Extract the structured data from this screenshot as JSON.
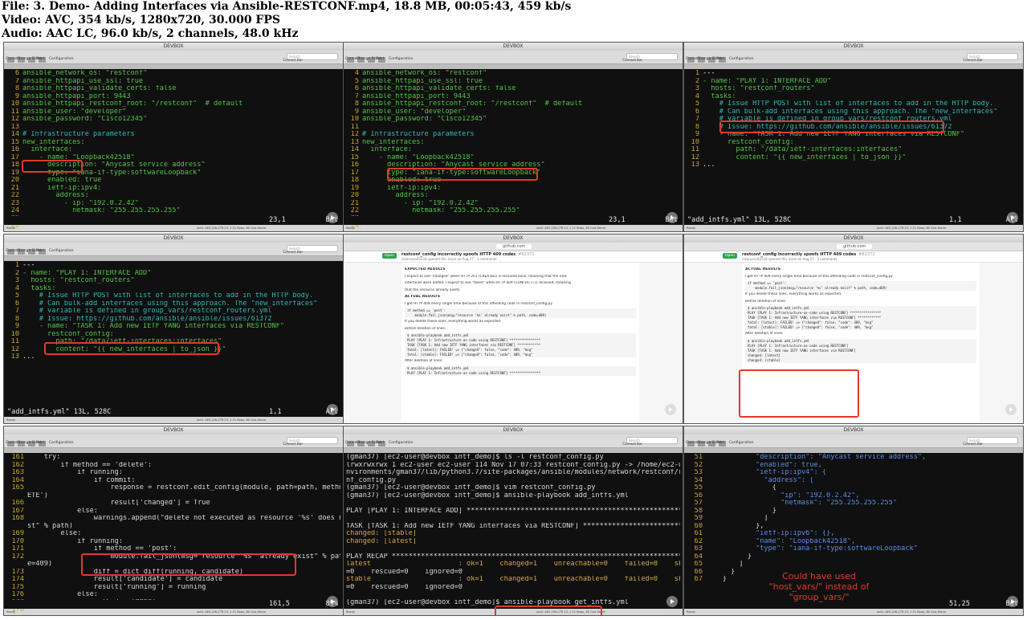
{
  "header": {
    "file": "File: 3. Demo- Adding Interfaces via Ansible-RESTCONF.mp4, 18.8 MB, 00:05:43, 459 kb/s",
    "video": "Video: AVC, 354 kb/s, 1280x720, 30.000 FPS",
    "audio": "Audio: AAC LC, 96.0 kb/s, 2 channels, 48.0 kHz"
  },
  "common": {
    "window_title": "DEVBOX",
    "tab_label": "devbox",
    "toolbar": [
      "Connect",
      "Change State",
      "Print",
      "Configuration"
    ],
    "search_placeholder": "Search",
    "connect_bar": "Connect Bar",
    "status_left": "Ready",
    "status_right": "ssh2: AES-256-CTR    23, 1    21 Rows, 80 Cols    Xterm",
    "browser_url": "github.com"
  },
  "tiles": [
    {
      "status": {
        "pos": "23,1",
        "pct": "Bot"
      },
      "lines": [
        {
          "n": "6",
          "t": "ansible_network_os: \"restconf\""
        },
        {
          "n": "7",
          "t": "ansible_httpapi_use_ssl: true"
        },
        {
          "n": "8",
          "t": "ansible_httpapi_validate_certs: false"
        },
        {
          "n": "9",
          "t": "ansible_httpapi_port: 9443"
        },
        {
          "n": "10",
          "t": "ansible_httpapi_restconf_root: \"/restconf\"  # default"
        },
        {
          "n": "11",
          "t": "ansible_user: \"developer\""
        },
        {
          "n": "12",
          "t": "ansible_password: \"C1sco12345\""
        },
        {
          "n": "13",
          "t": ""
        },
        {
          "n": "14",
          "t": "# Infrastructure parameters"
        },
        {
          "n": "15",
          "t": "new_interfaces:"
        },
        {
          "n": "16",
          "t": "  interface:"
        },
        {
          "n": "17",
          "t": "    - name: \"Loopback42518\""
        },
        {
          "n": "18",
          "t": "      description: \"Anycast service address\""
        },
        {
          "n": "19",
          "t": "      type: \"iana-if-type:softwareLoopback\""
        },
        {
          "n": "20",
          "t": "      enabled: true"
        },
        {
          "n": "21",
          "t": "      ietf-ip:ipv4:"
        },
        {
          "n": "22",
          "t": "        address:"
        },
        {
          "n": "23",
          "t": "          - ip: \"192.0.2.42\""
        },
        {
          "n": "24",
          "t": "            netmask: \"255.255.255.255\""
        },
        {
          "n": "25",
          "t": ""
        },
        {
          "n": "26",
          "t": "."
        }
      ]
    },
    {
      "status": {
        "pos": "23,1",
        "pct": "Bot"
      },
      "lines": [
        {
          "n": "4",
          "t": "ansible_network_os: \"restconf\""
        },
        {
          "n": "5",
          "t": "ansible_httpapi_use_ssl: true"
        },
        {
          "n": "6",
          "t": "ansible_httpapi_validate_certs: false"
        },
        {
          "n": "7",
          "t": "ansible_httpapi_port: 9443"
        },
        {
          "n": "8",
          "t": "ansible_httpapi_restconf_root: \"/restconf\"  # default"
        },
        {
          "n": "9",
          "t": "ansible_user: \"developer\""
        },
        {
          "n": "10",
          "t": "ansible_password: \"C1sco12345\""
        },
        {
          "n": "11",
          "t": ""
        },
        {
          "n": "12",
          "t": "# Infrastructure parameters"
        },
        {
          "n": "13",
          "t": "new_interfaces:"
        },
        {
          "n": "14",
          "t": "  interface:"
        },
        {
          "n": "15",
          "t": "    - name: \"Loopback42518\""
        },
        {
          "n": "16",
          "t": "      description: \"Anycast service address\""
        },
        {
          "n": "17",
          "t": "      type: \"iana-if-type:softwareLoopback\""
        },
        {
          "n": "18",
          "t": "      enabled: true"
        },
        {
          "n": "19",
          "t": "      ietf-ip:ipv4:"
        },
        {
          "n": "20",
          "t": "        address:"
        },
        {
          "n": "21",
          "t": "          - ip: \"192.0.2.42\""
        },
        {
          "n": "22",
          "t": "            netmask: \"255.255.255.255\""
        },
        {
          "n": "23",
          "t": ""
        },
        {
          "n": "24",
          "t": "."
        }
      ]
    },
    {
      "status": {
        "file": "\"add_intfs.yml\" 13L, 528C",
        "pos": "1,1",
        "pct": "All"
      },
      "lines": [
        {
          "n": "1",
          "t": "---"
        },
        {
          "n": "2",
          "t": "- name: \"PLAY 1: INTERFACE ADD\""
        },
        {
          "n": "3",
          "t": "  hosts: \"restconf_routers\""
        },
        {
          "n": "4",
          "t": "  tasks:"
        },
        {
          "n": "5",
          "t": "    # Issue HTTP POST with list of interfaces to add in the HTTP body."
        },
        {
          "n": "6",
          "t": "    # Can bulk-add interfaces using this approach. The \"new_interfaces\""
        },
        {
          "n": "7",
          "t": "    # variable is defined in group_vars/restconf_routers.yml"
        },
        {
          "n": "8",
          "t": "    # Issue: https://github.com/ansible/ansible/issues/61372"
        },
        {
          "n": "9",
          "t": "    - name: \"TASK 1: Add new IETF YANG interfaces via RESTCONF\""
        },
        {
          "n": "10",
          "t": "      restconf_config:"
        },
        {
          "n": "11",
          "t": "        path: \"/data/ietf-interfaces:interfaces\""
        },
        {
          "n": "12",
          "t": "        content: \"{{ new_interfaces | to_json }}\""
        },
        {
          "n": "13",
          "t": "..."
        }
      ]
    },
    {
      "status": {
        "file": "\"add_intfs.yml\" 13L, 528C",
        "pos": "1,1",
        "pct": "All"
      },
      "lines": [
        {
          "n": "1",
          "t": "---"
        },
        {
          "n": "2",
          "t": "- name: \"PLAY 1: INTERFACE ADD\""
        },
        {
          "n": "3",
          "t": "  hosts: \"restconf_routers\""
        },
        {
          "n": "4",
          "t": "  tasks:"
        },
        {
          "n": "5",
          "t": "    # Issue HTTP POST with list of interfaces to add in the HTTP body."
        },
        {
          "n": "6",
          "t": "    # Can bulk-add interfaces using this approach. The \"new_interfaces\""
        },
        {
          "n": "7",
          "t": "    # variable is defined in group_vars/restconf_routers.yml"
        },
        {
          "n": "8",
          "t": "    # Issue: https://github.com/ansible/ansible/issues/61372"
        },
        {
          "n": "9",
          "t": "    - name: \"TASK 1: Add new IETF YANG interfaces via RESTCONF\""
        },
        {
          "n": "10",
          "t": "      restconf_config:"
        },
        {
          "n": "11",
          "t": "        path: \"/data/ietf-interfaces:interfaces\""
        },
        {
          "n": "12",
          "t": "        content: \"{{ new_interfaces | to_json }}\""
        },
        {
          "n": "13",
          "t": "..."
        }
      ]
    },
    {
      "browser": true,
      "badge": "Open",
      "issue_title": "restconf_config incorrectly spoofs HTTP 409 codes",
      "issue_number": "#61372",
      "issue_sub": "nickrusso42518 opened this issue on Aug 27 · 3 comments",
      "blocks": [
        {
          "k": "h",
          "t": "EXPECTED RESULTS"
        },
        {
          "k": "p",
          "t": "I expect to see \"changed\" when HTTP 201 (CREATED) is received back, meaning that the new"
        },
        {
          "k": "p",
          "t": "interfaces were added. I expect to see \"failed\" when HTTP 409 (CONFLICT) is received, meaning"
        },
        {
          "k": "p",
          "t": "that the resource already exists."
        },
        {
          "k": "h",
          "t": "ACTUAL RESULTS"
        },
        {
          "k": "p",
          "t": "I get HTTP 409 every single time because of this offending code in restconf_config.py"
        },
        {
          "k": "c",
          "t": "if method == 'post':"
        },
        {
          "k": "c",
          "t": "    module.fail_json(msg=\"resource '%s' already exist\" % path, code=409)"
        },
        {
          "k": "p",
          "t": "If you delete these lines, everything works as expected."
        },
        {
          "k": "p",
          "t": "Before deletion of lines:"
        },
        {
          "k": "c",
          "t": "$ ansible-playbook add_intfs.yml"
        },
        {
          "k": "c",
          "t": "PLAY [PLAY 1: Infrastructure-as-code using RESTCONF] ****************"
        },
        {
          "k": "c",
          "t": "TASK [TASK 1: Add new IETF YANG interfaces via RESTCONF] ************"
        },
        {
          "k": "c",
          "t": "fatal: [latest]: FAILED! => {\"changed\": false, \"code\": 409, \"msg\""
        },
        {
          "k": "c",
          "t": "fatal: [stable]: FAILED! => {\"changed\": false, \"code\": 409, \"msg\""
        },
        {
          "k": "p",
          "t": "After deletion of lines:"
        },
        {
          "k": "c",
          "t": "$ ansible-playbook add_intfs.yml"
        },
        {
          "k": "c",
          "t": "PLAY [PLAY 1: Infrastructure-as-code using RESTCONF] ****************"
        }
      ]
    },
    {
      "browser": true,
      "badge": "Open",
      "issue_title": "restconf_config incorrectly spoofs HTTP 409 codes",
      "issue_number": "#61372",
      "issue_sub": "nickrusso42518 opened this issue on Aug 27 · 3 comments",
      "blocks": [
        {
          "k": "h",
          "t": "ACTUAL RESULTS"
        },
        {
          "k": "p",
          "t": "I get HTTP 409 every single time because of this offending code in restconf_config.py"
        },
        {
          "k": "c",
          "t": "if method == 'post':"
        },
        {
          "k": "c",
          "t": "    module.fail_json(msg=\"resource '%s' already exist\" % path, code=409)"
        },
        {
          "k": "p",
          "t": "If you delete these lines, everything works as expected."
        },
        {
          "k": "p",
          "t": "Before deletion of lines:"
        },
        {
          "k": "c",
          "t": "$ ansible-playbook add_intfs.yml"
        },
        {
          "k": "c",
          "t": "PLAY [PLAY 1: Infrastructure-as-code using RESTCONF] ****************"
        },
        {
          "k": "c",
          "t": "TASK [TASK 1: Add new IETF YANG interfaces via RESTCONF] ************"
        },
        {
          "k": "c",
          "t": "fatal: [latest]: FAILED! => {\"changed\": false, \"code\": 409, \"msg\""
        },
        {
          "k": "c",
          "t": "fatal: [stable]: FAILED! => {\"changed\": false, \"code\": 409, \"msg\""
        },
        {
          "k": "p",
          "t": "After deletion of lines:"
        },
        {
          "k": "c",
          "t": "$ ansible-playbook add_intfs.yml"
        },
        {
          "k": "c",
          "t": "PLAY [PLAY 1: Infrastructure-as-code using RESTCONF]"
        },
        {
          "k": "c",
          "t": "TASK [TASK 1: Add new IETF YANG interfaces via RESTCONF]"
        },
        {
          "k": "c",
          "t": "changed: [latest]"
        },
        {
          "k": "c",
          "t": "changed: [stable]"
        }
      ]
    },
    {
      "status": {
        "pos": "161,5",
        "pct": "89%"
      },
      "lines": [
        {
          "n": "161",
          "t": "    try:"
        },
        {
          "n": "162",
          "t": "        if method == 'delete':"
        },
        {
          "n": "163",
          "t": "            if running:"
        },
        {
          "n": "164",
          "t": "                if commit:"
        },
        {
          "n": "165",
          "t": "                    response = restconf.edit_config(module, path=path, method='DEL"
        },
        {
          "n": "",
          "t": "ETE')"
        },
        {
          "n": "166",
          "t": "                    result['changed'] = True"
        },
        {
          "n": "167",
          "t": "            else:"
        },
        {
          "n": "168",
          "t": "                warnings.append(\"delete not executed as resource '%s' does not exi"
        },
        {
          "n": "",
          "t": "st\" % path)"
        },
        {
          "n": "169",
          "t": "        else:"
        },
        {
          "n": "170",
          "t": "            if running:"
        },
        {
          "n": "171",
          "t": "                if method == 'post':"
        },
        {
          "n": "172",
          "t": "                    module.fail_json(msg=\"resource '%s' already exist\" % path, cod"
        },
        {
          "n": "",
          "t": "e=409)"
        },
        {
          "n": "173",
          "t": "                diff = dict_diff(running, candidate)"
        },
        {
          "n": "174",
          "t": "                result['candidate'] = candidate"
        },
        {
          "n": "175",
          "t": "                result['running'] = running"
        },
        {
          "n": "176",
          "t": "            else:"
        },
        {
          "n": "177",
          "t": "                method = 'POST'"
        },
        {
          "n": "178",
          "t": ""
        }
      ]
    },
    {
      "lines": [
        {
          "t": "(gman37) [ec2-user@devbox intf_demo]$ ls -l restconf_config.py"
        },
        {
          "t": "lrwxrwxrwx 1 ec2-user ec2-user 114 Nov 17 07:33 restconf_config.py -> /home/ec2-user/e"
        },
        {
          "t": "nvironments/gman37/lib/python3.7/site-packages/ansible/modules/network/restconf/restco"
        },
        {
          "t": "nf_config.py"
        },
        {
          "t": "(gman37) [ec2-user@devbox intf_demo]$ vim restconf_config.py"
        },
        {
          "t": "(gman37) [ec2-user@devbox intf_demo]$ ansible-playbook add_intfs.yml"
        },
        {
          "t": ""
        },
        {
          "t": "PLAY [PLAY 1: INTERFACE ADD] **********************************************************"
        },
        {
          "t": ""
        },
        {
          "t": "TASK [TASK 1: Add new IETF YANG interfaces via RESTCONF] ******************************"
        },
        {
          "t": "changed: [stable]"
        },
        {
          "t": "changed: [latest]"
        },
        {
          "t": ""
        },
        {
          "t": "PLAY RECAP ****************************************************************************"
        },
        {
          "t": "latest                     : ok=1    changed=1    unreachable=0    failed=0    skipped"
        },
        {
          "t": "=0    rescued=0    ignored=0"
        },
        {
          "t": "stable                     : ok=1    changed=1    unreachable=0    failed=0    skipped"
        },
        {
          "t": "=0    rescued=0    ignored=0"
        },
        {
          "t": ""
        },
        {
          "t": "(gman37) [ec2-user@devbox intf_demo]$ ansible-playbook get_intfs.yml"
        }
      ]
    },
    {
      "status": {
        "pos": "51,25",
        "pct": "Bot"
      },
      "note": "Could have used \"host_vars/\" instead of \"group_vars/\"",
      "lines": [
        {
          "n": "51",
          "t": "            \"description\": \"Anycast service address\","
        },
        {
          "n": "52",
          "t": "            \"enabled\": true,"
        },
        {
          "n": "53",
          "t": "            \"ietf-ip:ipv4\": {"
        },
        {
          "n": "54",
          "t": "              \"address\": ["
        },
        {
          "n": "55",
          "t": "                {"
        },
        {
          "n": "56",
          "t": "                  \"ip\": \"192.0.2.42\","
        },
        {
          "n": "57",
          "t": "                  \"netmask\": \"255.255.255.255\""
        },
        {
          "n": "58",
          "t": "                }"
        },
        {
          "n": "59",
          "t": "              ]"
        },
        {
          "n": "60",
          "t": "            },"
        },
        {
          "n": "61",
          "t": "            \"ietf-ip:ipv6\": {},"
        },
        {
          "n": "62",
          "t": "            \"name\": \"Loopback42518\","
        },
        {
          "n": "63",
          "t": "            \"type\": \"iana-if-type:softwareLoopback\""
        },
        {
          "n": "64",
          "t": "          }"
        },
        {
          "n": "65",
          "t": "        ]"
        },
        {
          "n": "66",
          "t": "      }"
        },
        {
          "n": "67",
          "t": "    }"
        }
      ]
    }
  ]
}
